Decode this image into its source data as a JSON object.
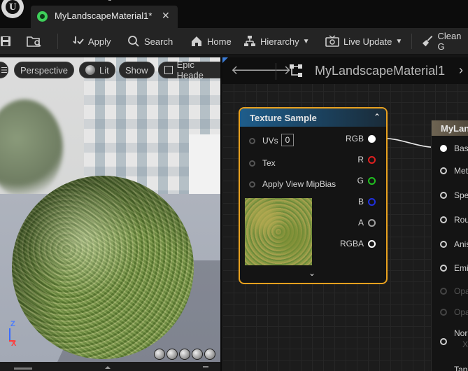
{
  "tab": {
    "title": "MyLandscapeMaterial1*",
    "close": "✕"
  },
  "toolbar": {
    "apply": "Apply",
    "search": "Search",
    "home": "Home",
    "hierarchy": "Hierarchy",
    "live_update": "Live Update",
    "clean": "Clean G"
  },
  "viewport": {
    "perspective": "Perspective",
    "lit": "Lit",
    "show": "Show",
    "epic": "Epic Heade",
    "axis_z": "Z",
    "axis_x": "X"
  },
  "graph": {
    "title": "MyLandscapeMaterial1",
    "back_icon": "arrow-left-icon",
    "forward_icon": "arrow-right-icon"
  },
  "texture_node": {
    "title": "Texture Sample",
    "inputs": [
      "UVs",
      "Tex",
      "Apply View MipBias"
    ],
    "uv_value": "0",
    "outputs": [
      {
        "label": "RGB",
        "color": "#ffffff"
      },
      {
        "label": "R",
        "color": "#e02020"
      },
      {
        "label": "G",
        "color": "#20c020"
      },
      {
        "label": "B",
        "color": "#2030e0"
      },
      {
        "label": "A",
        "color": "#a0a0a0"
      },
      {
        "label": "RGBA",
        "color": "#ffffff"
      }
    ]
  },
  "material_node": {
    "title": "MyLan",
    "inputs": [
      {
        "label": "Bas",
        "dim": false
      },
      {
        "label": "Met",
        "dim": false
      },
      {
        "label": "Spe",
        "dim": false
      },
      {
        "label": "Rou",
        "dim": false
      },
      {
        "label": "Anis",
        "dim": false
      },
      {
        "label": "Emi",
        "dim": false
      },
      {
        "label": "Opa",
        "dim": true
      },
      {
        "label": "Opa",
        "dim": true
      },
      {
        "label": "Nor",
        "dim": false
      }
    ],
    "sub_x": "X",
    "tail": "Tan"
  },
  "colors": {
    "node_border": "#e8a11f",
    "texture_header": "#1e5d8b",
    "material_header": "#6e6453"
  }
}
